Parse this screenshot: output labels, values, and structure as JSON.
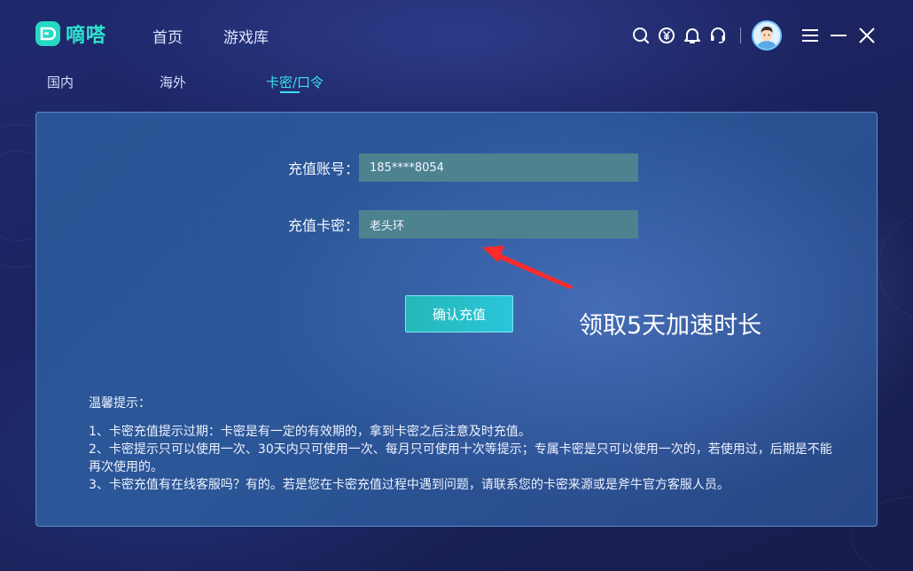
{
  "app": {
    "name": "嘀嗒"
  },
  "nav": {
    "items": [
      "首页",
      "游戏库"
    ]
  },
  "top_icons": [
    "search-icon",
    "yuan-coin-icon",
    "bell-icon",
    "headset-icon"
  ],
  "subtabs": {
    "items": [
      "国内",
      "海外",
      "卡密/口令"
    ],
    "active": "卡密/口令"
  },
  "form": {
    "account_label": "充值账号：",
    "account_value": "185****8054",
    "card_label": "充值卡密：",
    "card_value": "老头环",
    "confirm_label": "确认充值"
  },
  "promo": {
    "text": "领取5天加速时长"
  },
  "tips": {
    "title": "温馨提示：",
    "items": [
      "1、卡密充值提示过期：卡密是有一定的有效期的，拿到卡密之后注意及时充值。",
      "2、卡密提示只可以使用一次、30天内只可使用一次、每月只可使用十次等提示；专属卡密是只可以使用一次的，若使用过，后期是不能再次使用的。",
      "3、卡密充值有在线客服吗？有的。若是您在卡密充值过程中遇到问题，请联系您的卡密来源或是斧牛官方客服人员。"
    ]
  },
  "colors": {
    "accent": "#3fe0e8",
    "logo": "#2fe3cf",
    "field_bg": "#4d828f",
    "annotation_arrow": "#ff2a2a"
  }
}
